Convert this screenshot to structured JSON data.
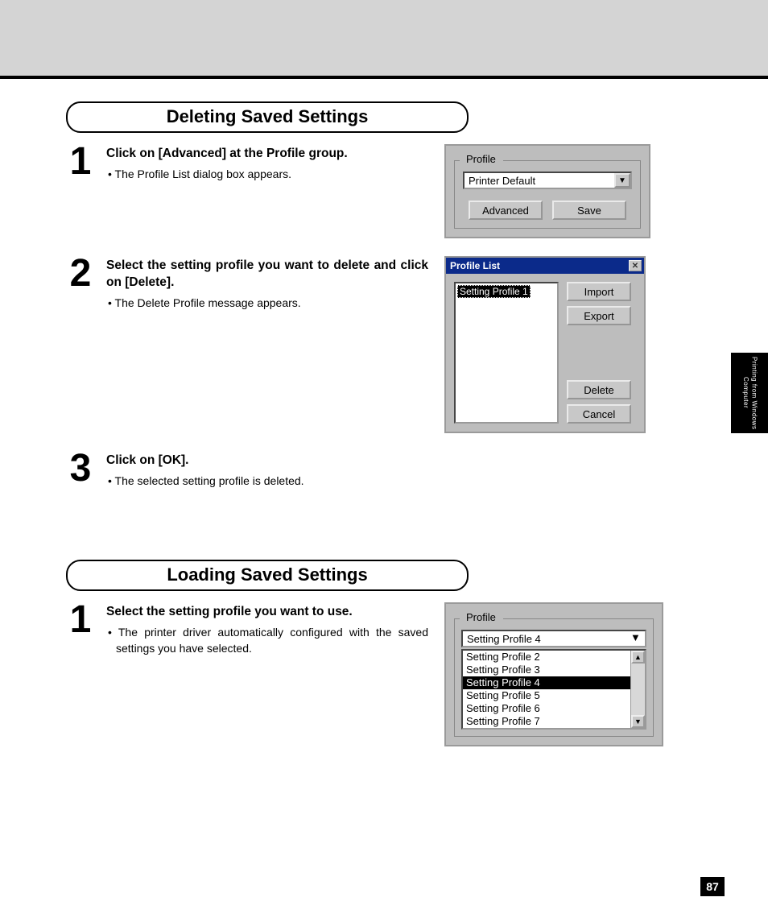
{
  "section1": {
    "title": "Deleting Saved Settings",
    "step1": {
      "num": "1",
      "bold": "Click on [Advanced] at the Profile group.",
      "bullet": "The Profile List dialog box appears.",
      "shot": {
        "group_label": "Profile",
        "dropdown_value": "Printer Default",
        "btn_advanced": "Advanced",
        "btn_save": "Save"
      }
    },
    "step2": {
      "num": "2",
      "bold": "Select the setting profile you want to delete and click on [Delete].",
      "bullet": "The Delete Profile message appears.",
      "shot": {
        "title": "Profile List",
        "list_item": "Setting Profile 1",
        "btn_import": "Import",
        "btn_export": "Export",
        "btn_delete": "Delete",
        "btn_cancel": "Cancel"
      }
    },
    "step3": {
      "num": "3",
      "bold": "Click on [OK].",
      "bullet": "The selected setting profile is deleted."
    }
  },
  "section2": {
    "title": "Loading Saved Settings",
    "step1": {
      "num": "1",
      "bold": "Select the setting profile you want to use.",
      "bullet": "The printer driver automatically configured with the saved settings you have selected.",
      "shot": {
        "group_label": "Profile",
        "current": "Setting Profile 4",
        "options": {
          "o0": "Setting Profile 2",
          "o1": "Setting Profile 3",
          "o2": "Setting Profile 4",
          "o3": "Setting Profile 5",
          "o4": "Setting Profile 6",
          "o5": "Setting Profile 7"
        }
      }
    }
  },
  "sidetab": "Printing from\nWindows Computer",
  "page_number": "87"
}
